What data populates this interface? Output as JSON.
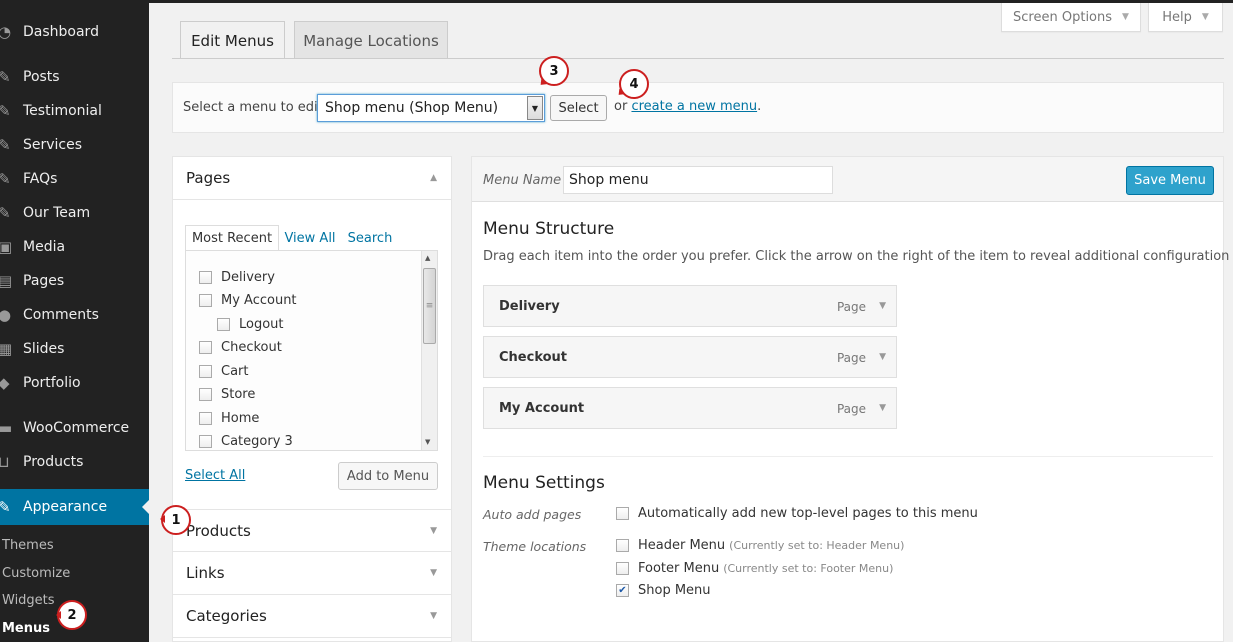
{
  "sidebar": {
    "items": [
      {
        "label": "Dashboard",
        "icon": "dashboard-icon",
        "glyph": "◔"
      },
      {
        "label": "Posts",
        "icon": "pin-icon",
        "glyph": "✎"
      },
      {
        "label": "Testimonial",
        "icon": "pin-icon",
        "glyph": "✎"
      },
      {
        "label": "Services",
        "icon": "pin-icon",
        "glyph": "✎"
      },
      {
        "label": "FAQs",
        "icon": "pin-icon",
        "glyph": "✎"
      },
      {
        "label": "Our Team",
        "icon": "pin-icon",
        "glyph": "✎"
      },
      {
        "label": "Media",
        "icon": "media-icon",
        "glyph": "▣"
      },
      {
        "label": "Pages",
        "icon": "pages-icon",
        "glyph": "▤"
      },
      {
        "label": "Comments",
        "icon": "comments-icon",
        "glyph": "●"
      },
      {
        "label": "Slides",
        "icon": "slides-icon",
        "glyph": "▦"
      },
      {
        "label": "Portfolio",
        "icon": "portfolio-icon",
        "glyph": "◆"
      },
      {
        "label": "WooCommerce",
        "icon": "woocommerce-icon",
        "glyph": "▬"
      },
      {
        "label": "Products",
        "icon": "cart-icon",
        "glyph": "⊔"
      },
      {
        "label": "Appearance",
        "icon": "appearance-icon",
        "glyph": "✎"
      }
    ],
    "submenu": [
      "Themes",
      "Customize",
      "Widgets",
      "Menus"
    ]
  },
  "screen_options": {
    "label": "Screen Options",
    "caret": "▼"
  },
  "help": {
    "label": "Help",
    "caret": "▼"
  },
  "tabs": {
    "edit": "Edit Menus",
    "manage": "Manage Locations"
  },
  "manage": {
    "label": "Select a menu to edit:",
    "selected": "Shop menu (Shop Menu)",
    "select_button": "Select",
    "or": "or",
    "create_link": "create a new menu",
    "period": "."
  },
  "accordion": {
    "pages_title": "Pages",
    "subtabs": [
      "Most Recent",
      "View All",
      "Search"
    ],
    "pages": [
      {
        "label": "Delivery",
        "indent": false
      },
      {
        "label": "My Account",
        "indent": false
      },
      {
        "label": "Logout",
        "indent": true
      },
      {
        "label": "Checkout",
        "indent": false
      },
      {
        "label": "Cart",
        "indent": false
      },
      {
        "label": "Store",
        "indent": false
      },
      {
        "label": "Home",
        "indent": false
      },
      {
        "label": "Category 3",
        "indent": false
      }
    ],
    "select_all": "Select All",
    "add_to_menu": "Add to Menu",
    "sections": [
      "Products",
      "Links",
      "Categories"
    ]
  },
  "menu_edit": {
    "name_label": "Menu Name",
    "name_value": "Shop menu",
    "save": "Save Menu",
    "structure_title": "Menu Structure",
    "instructions": "Drag each item into the order you prefer. Click the arrow on the right of the item to reveal additional configuration options.",
    "items": [
      {
        "title": "Delivery",
        "type": "Page"
      },
      {
        "title": "Checkout",
        "type": "Page"
      },
      {
        "title": "My Account",
        "type": "Page"
      }
    ],
    "settings_title": "Menu Settings",
    "auto_add_label": "Auto add pages",
    "auto_add_text": "Automatically add new top-level pages to this menu",
    "theme_locations_label": "Theme locations",
    "locations": [
      {
        "name": "Header Menu",
        "note": "(Currently set to: Header Menu)",
        "checked": false
      },
      {
        "name": "Footer Menu",
        "note": "(Currently set to: Footer Menu)",
        "checked": false
      },
      {
        "name": "Shop Menu",
        "note": "",
        "checked": true
      }
    ]
  },
  "callouts": [
    "1",
    "2",
    "3",
    "4"
  ],
  "colors": {
    "sidebar": "#222222",
    "accent": "#0074a2",
    "save": "#2ea2cc",
    "callout": "#cc1f1f"
  }
}
